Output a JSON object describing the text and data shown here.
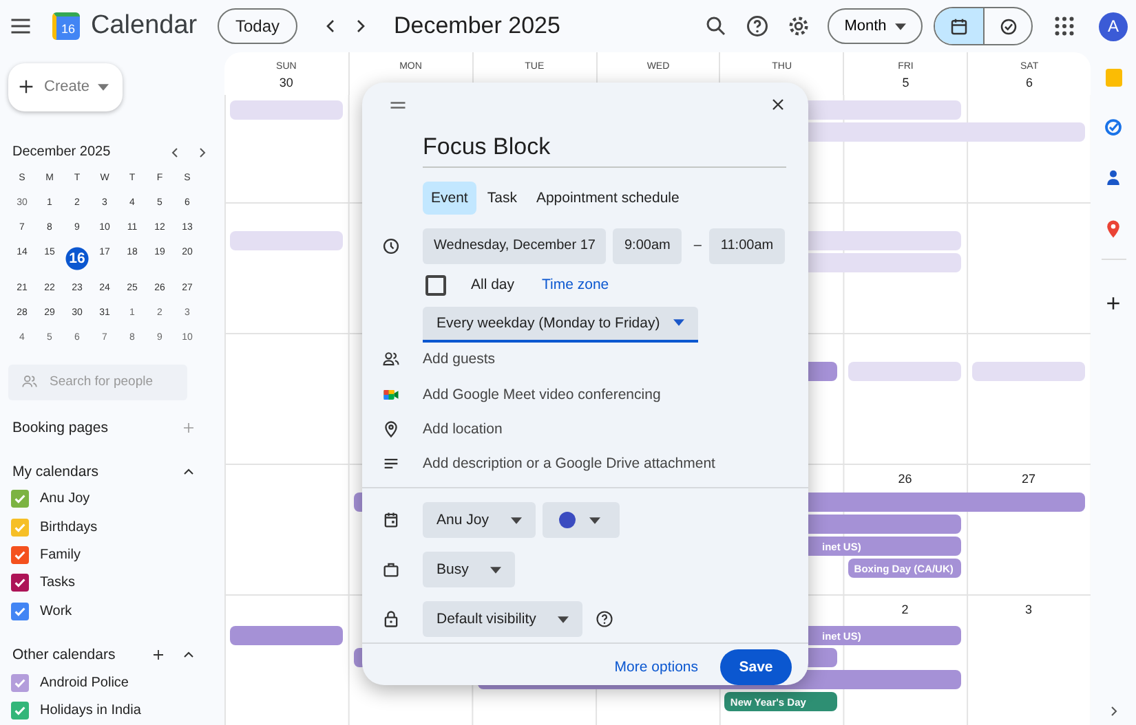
{
  "header": {
    "app_name": "Calendar",
    "logo_text": "16",
    "today_button": "Today",
    "period": "December 2025",
    "view_select": "Month",
    "view_toggle": [
      {
        "kind": "calendar",
        "selected": true
      },
      {
        "kind": "tasks",
        "selected": false
      }
    ],
    "avatar": "A"
  },
  "sidebar": {
    "create_button": "Create",
    "mini_calendar": {
      "title": "December 2025",
      "weekdays": [
        "S",
        "M",
        "T",
        "W",
        "T",
        "F",
        "S"
      ],
      "weeks": [
        [
          {
            "day": "30",
            "in_month": false,
            "selected": false
          },
          {
            "day": "1",
            "in_month": true,
            "selected": false
          },
          {
            "day": "2",
            "in_month": true,
            "selected": false
          },
          {
            "day": "3",
            "in_month": true,
            "selected": false
          },
          {
            "day": "4",
            "in_month": true,
            "selected": false
          },
          {
            "day": "5",
            "in_month": true,
            "selected": false
          },
          {
            "day": "6",
            "in_month": true,
            "selected": false
          }
        ],
        [
          {
            "day": "7",
            "in_month": true,
            "selected": false
          },
          {
            "day": "8",
            "in_month": true,
            "selected": false
          },
          {
            "day": "9",
            "in_month": true,
            "selected": false
          },
          {
            "day": "10",
            "in_month": true,
            "selected": false
          },
          {
            "day": "11",
            "in_month": true,
            "selected": false
          },
          {
            "day": "12",
            "in_month": true,
            "selected": false
          },
          {
            "day": "13",
            "in_month": true,
            "selected": false
          }
        ],
        [
          {
            "day": "14",
            "in_month": true,
            "selected": false
          },
          {
            "day": "15",
            "in_month": true,
            "selected": false
          },
          {
            "day": "16",
            "in_month": true,
            "selected": true
          },
          {
            "day": "17",
            "in_month": true,
            "selected": false
          },
          {
            "day": "18",
            "in_month": true,
            "selected": false
          },
          {
            "day": "19",
            "in_month": true,
            "selected": false
          },
          {
            "day": "20",
            "in_month": true,
            "selected": false
          }
        ],
        [
          {
            "day": "21",
            "in_month": true,
            "selected": false
          },
          {
            "day": "22",
            "in_month": true,
            "selected": false
          },
          {
            "day": "23",
            "in_month": true,
            "selected": false
          },
          {
            "day": "24",
            "in_month": true,
            "selected": false
          },
          {
            "day": "25",
            "in_month": true,
            "selected": false
          },
          {
            "day": "26",
            "in_month": true,
            "selected": false
          },
          {
            "day": "27",
            "in_month": true,
            "selected": false
          }
        ],
        [
          {
            "day": "28",
            "in_month": true,
            "selected": false
          },
          {
            "day": "29",
            "in_month": true,
            "selected": false
          },
          {
            "day": "30",
            "in_month": true,
            "selected": false
          },
          {
            "day": "31",
            "in_month": true,
            "selected": false
          },
          {
            "day": "1",
            "in_month": false,
            "selected": false
          },
          {
            "day": "2",
            "in_month": false,
            "selected": false
          },
          {
            "day": "3",
            "in_month": false,
            "selected": false
          }
        ],
        [
          {
            "day": "4",
            "in_month": false,
            "selected": false
          },
          {
            "day": "5",
            "in_month": false,
            "selected": false
          },
          {
            "day": "6",
            "in_month": false,
            "selected": false
          },
          {
            "day": "7",
            "in_month": false,
            "selected": false
          },
          {
            "day": "8",
            "in_month": false,
            "selected": false
          },
          {
            "day": "9",
            "in_month": false,
            "selected": false
          },
          {
            "day": "10",
            "in_month": false,
            "selected": false
          }
        ]
      ]
    },
    "people_search": {
      "placeholder": "Search for people"
    },
    "booking_pages": "Booking pages",
    "my_calendars": {
      "title": "My calendars",
      "expanded": true,
      "items": [
        {
          "name": "Anu Joy",
          "checked": true,
          "color": "#7cb342"
        },
        {
          "name": "Birthdays",
          "checked": true,
          "color": "#f6bf26"
        },
        {
          "name": "Family",
          "checked": true,
          "color": "#f4511e"
        },
        {
          "name": "Tasks",
          "checked": true,
          "color": "#ad1457"
        },
        {
          "name": "Work",
          "checked": true,
          "color": "#4285f4"
        }
      ]
    },
    "other_calendars": {
      "title": "Other calendars",
      "expanded": true,
      "items": [
        {
          "name": "Android Police",
          "checked": true,
          "color": "#b39ddb"
        },
        {
          "name": "Holidays in India",
          "checked": true,
          "color": "#33b679"
        }
      ]
    }
  },
  "month_grid": {
    "columns": [
      {
        "label": "SUN",
        "date": "30"
      },
      {
        "label": "MON"
      },
      {
        "label": "TUE"
      },
      {
        "label": "WED"
      },
      {
        "label": "THU"
      },
      {
        "label": "FRI",
        "date": "5"
      },
      {
        "label": "SAT",
        "date": "6"
      }
    ],
    "weeks": [
      {
        "events": [
          {
            "kind": "obscured"
          },
          {
            "kind": "obscured"
          },
          {
            "kind": "obscured"
          }
        ]
      },
      {
        "events": [
          {
            "kind": "obscured"
          },
          {
            "kind": "obscured"
          },
          {
            "kind": "obscured"
          }
        ]
      },
      {
        "events": [
          {
            "kind": "chip",
            "color": "#a591d6"
          },
          {
            "kind": "obscured"
          },
          {
            "kind": "obscured"
          }
        ]
      },
      {
        "dates": [
          "26",
          "27"
        ],
        "events": [
          {
            "kind": "chip",
            "color": "#a591d6"
          },
          {
            "kind": "chip",
            "color": "#a591d6"
          },
          {
            "kind": "chip",
            "color": "#a591d6",
            "text": "inet US)"
          },
          {
            "kind": "chip",
            "color": "#a591d6",
            "text": "Boxing Day (CA/UK)"
          }
        ]
      },
      {
        "dates": [
          "2",
          "3"
        ],
        "events": [
          {
            "kind": "chip",
            "color": "#a591d6"
          },
          {
            "kind": "chip",
            "color": "#a591d6",
            "text": "inet US)"
          },
          {
            "kind": "chip",
            "color": "#a591d6"
          },
          {
            "kind": "chip",
            "color": "#a591d6"
          },
          {
            "kind": "chip",
            "color": "#2e8f73",
            "text": "New Year's Day"
          }
        ]
      }
    ]
  },
  "event_dialog": {
    "title_value": "Focus Block",
    "tabs": [
      {
        "label": "Event",
        "selected": true
      },
      {
        "label": "Task",
        "selected": false
      },
      {
        "label": "Appointment schedule",
        "selected": false
      }
    ],
    "date": "Wednesday, December 17",
    "start_time": "9:00am",
    "separator": "–",
    "end_time": "11:00am",
    "all_day": {
      "label": "All day",
      "checked": false
    },
    "time_zone_link": "Time zone",
    "recurrence": "Every weekday (Monday to Friday)",
    "options": [
      {
        "kind": "guests",
        "label": "Add guests"
      },
      {
        "kind": "meet",
        "label": "Add Google Meet video conferencing"
      },
      {
        "kind": "location",
        "label": "Add location"
      },
      {
        "kind": "description",
        "label": "Add description or a Google Drive attachment"
      }
    ],
    "calendar_select": "Anu Joy",
    "availability": "Busy",
    "visibility": "Default visibility",
    "more_options": "More options",
    "save_button": "Save"
  }
}
